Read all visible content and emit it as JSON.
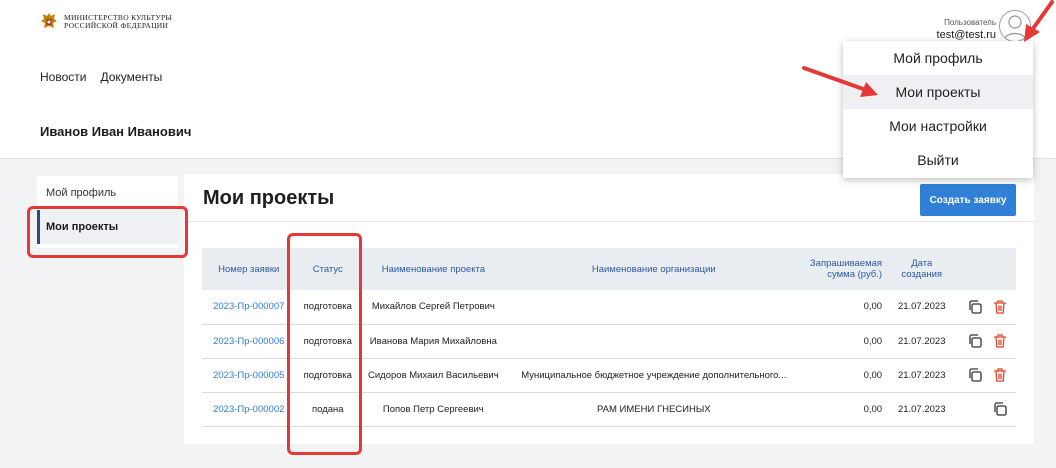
{
  "header": {
    "logo_line1": "МИНИСТЕРСТВО КУЛЬТУРЫ",
    "logo_line2": "РОССИЙСКОЙ ФЕДЕРАЦИИ",
    "nav": [
      "Новости",
      "Документы"
    ],
    "user_role": "Пользователь",
    "user_email": "test@test.ru"
  },
  "person_name": "Иванов Иван Иванович",
  "sidebar": {
    "items": [
      {
        "label": "Мой профиль"
      },
      {
        "label": "Мои проекты"
      }
    ]
  },
  "main": {
    "title": "Мои проекты",
    "create_button": "Создать заявку",
    "table": {
      "headers": [
        "Номер заявки",
        "Статус",
        "Наименование проекта",
        "Наименование организации",
        "Запрашиваемая сумма (руб.)",
        "Дата создания"
      ],
      "rows": [
        {
          "num": "2023-Пр-000007",
          "status": "подготовка",
          "project": "Михайлов Сергей Петрович",
          "org": "",
          "sum": "0,00",
          "date": "21.07.2023"
        },
        {
          "num": "2023-Пр-000006",
          "status": "подготовка",
          "project": "Иванова Мария Михайловна",
          "org": "",
          "sum": "0,00",
          "date": "21.07.2023"
        },
        {
          "num": "2023-Пр-000005",
          "status": "подготовка",
          "project": "Сидоров Михаил Васильевич",
          "org": "Муниципальное бюджетное учреждение дополнительного...",
          "sum": "0,00",
          "date": "21.07.2023"
        },
        {
          "num": "2023-Пр-000002",
          "status": "подана",
          "project": "Попов Петр Сергеевич",
          "org": "РАМ ИМЕНИ ГНЕСИНЫХ",
          "sum": "0,00",
          "date": "21.07.2023"
        }
      ]
    }
  },
  "dropdown": {
    "items": [
      "Мой профиль",
      "Мои проекты",
      "Мои настройки",
      "Выйти"
    ]
  },
  "colors": {
    "accent": "#2f80d6",
    "link": "#2f7dd1",
    "delete": "#e0452b",
    "highlight": "#e53935"
  },
  "icons": [
    "emblem-icon",
    "avatar-icon",
    "copy-icon",
    "trash-icon",
    "arrow-annotation"
  ]
}
